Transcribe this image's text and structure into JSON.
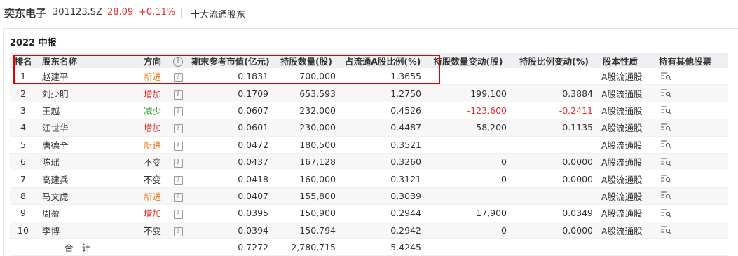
{
  "header": {
    "stock_name": "奕东电子",
    "stock_code": "301123.SZ",
    "price": "28.09",
    "change": "+0.11%",
    "section_title": "十大流通股东"
  },
  "period": "2022 中报",
  "columns": [
    "排名",
    "股东名称",
    "方向",
    "期末参考市值(亿元)",
    "持股数量(股)",
    "占流通A股比例(%)",
    "持股数量变动(股)",
    "持股比例变动(%)",
    "股本性质",
    "持有其他股票"
  ],
  "help_icon": "?",
  "rows": [
    {
      "rank": "1",
      "name": "赵建平",
      "direction": "新进",
      "dir_type": "new",
      "market_value": "0.1831",
      "shares": "700,000",
      "ratio": "1.3655",
      "share_change": "",
      "ratio_change": "",
      "share_type": "A股流通股"
    },
    {
      "rank": "2",
      "name": "刘少明",
      "direction": "增加",
      "dir_type": "up",
      "market_value": "0.1709",
      "shares": "653,593",
      "ratio": "1.2750",
      "share_change": "199,100",
      "ratio_change": "0.3884",
      "share_type": "A股流通股"
    },
    {
      "rank": "3",
      "name": "王越",
      "direction": "减少",
      "dir_type": "down",
      "market_value": "0.0607",
      "shares": "232,000",
      "ratio": "0.4526",
      "share_change": "-123,600",
      "ratio_change": "-0.2411",
      "share_type": "A股流通股"
    },
    {
      "rank": "4",
      "name": "江世华",
      "direction": "增加",
      "dir_type": "up",
      "market_value": "0.0601",
      "shares": "230,000",
      "ratio": "0.4487",
      "share_change": "58,200",
      "ratio_change": "0.1135",
      "share_type": "A股流通股"
    },
    {
      "rank": "5",
      "name": "唐德全",
      "direction": "新进",
      "dir_type": "new",
      "market_value": "0.0472",
      "shares": "180,500",
      "ratio": "0.3521",
      "share_change": "",
      "ratio_change": "",
      "share_type": "A股流通股"
    },
    {
      "rank": "6",
      "name": "陈瑶",
      "direction": "不变",
      "dir_type": "flat",
      "market_value": "0.0437",
      "shares": "167,128",
      "ratio": "0.3260",
      "share_change": "0",
      "ratio_change": "0.0000",
      "share_type": "A股流通股"
    },
    {
      "rank": "7",
      "name": "高建兵",
      "direction": "不变",
      "dir_type": "flat",
      "market_value": "0.0418",
      "shares": "160,000",
      "ratio": "0.3121",
      "share_change": "0",
      "ratio_change": "0.0000",
      "share_type": "A股流通股"
    },
    {
      "rank": "8",
      "name": "马文虎",
      "direction": "新进",
      "dir_type": "new",
      "market_value": "0.0407",
      "shares": "155,800",
      "ratio": "0.3039",
      "share_change": "",
      "ratio_change": "",
      "share_type": "A股流通股"
    },
    {
      "rank": "9",
      "name": "周盈",
      "direction": "增加",
      "dir_type": "up",
      "market_value": "0.0395",
      "shares": "150,900",
      "ratio": "0.2944",
      "share_change": "17,900",
      "ratio_change": "0.0349",
      "share_type": "A股流通股"
    },
    {
      "rank": "10",
      "name": "李博",
      "direction": "不变",
      "dir_type": "flat",
      "market_value": "0.0394",
      "shares": "150,794",
      "ratio": "0.2942",
      "share_change": "0",
      "ratio_change": "0.0000",
      "share_type": "A股流通股"
    }
  ],
  "total": {
    "label": "合　计",
    "market_value": "0.7272",
    "shares": "2,780,715",
    "ratio": "5.4245"
  },
  "colors": {
    "up": "#e03030",
    "down": "#2a9a2a",
    "new": "#e07b20",
    "highlight_box": "#e00000",
    "header_bg": "#eef0f3"
  },
  "icons": {
    "direction_help": "question-circle-icon",
    "change_reason": "question-square-icon",
    "other_holdings": "list-search-icon"
  }
}
